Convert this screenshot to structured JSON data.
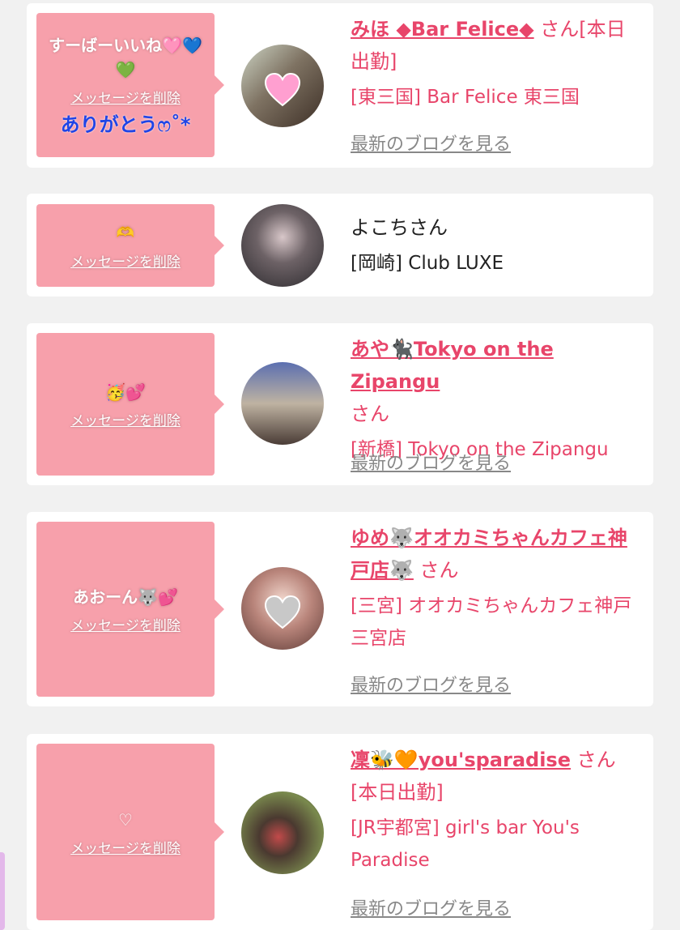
{
  "delete_label": "メッセージを削除",
  "blog_label": "最新のブログを見る",
  "colors": {
    "accent": "#e8456a",
    "bubble": "#f7a0ab",
    "background": "#f1f1f1",
    "card": "#ffffff",
    "link_gray": "#888888"
  },
  "cards": [
    {
      "message": "すーばーいいね🩷💙💚",
      "extra": "ありがとうෆ˚*",
      "name": "みほ ◆Bar Felice◆",
      "san": " さん[本日出勤]",
      "shop": "[東三国] Bar Felice 東三国",
      "avatar_icon": "pink-heart-sticker",
      "has_blog": true
    },
    {
      "message": "🫶",
      "name": "よこち",
      "san": "さん",
      "shop": "[岡崎] Club LUXE",
      "avatar_icon": "none",
      "has_blog": false
    },
    {
      "message": "🥳💕",
      "name": "あや🐈‍⬛Tokyo on the Zipangu",
      "san": " さん",
      "shop": "[新橋] Tokyo on the Zipangu",
      "avatar_icon": "none",
      "has_blog": true
    },
    {
      "message": "あおーん🐺💕",
      "name": "ゆめ🐺オオカミちゃんカフェ神戸店🐺",
      "san": " さん",
      "shop": "[三宮] オオカミちゃんカフェ神戸三宮店",
      "avatar_icon": "gray-heart-sticker",
      "has_blog": true
    },
    {
      "message": "♡",
      "name": "凜🐝🧡you'sparadise",
      "san": " さん[本日出勤]",
      "shop": "[JR宇都宮] girl's bar You's Paradise",
      "avatar_icon": "none",
      "has_blog": true
    }
  ]
}
